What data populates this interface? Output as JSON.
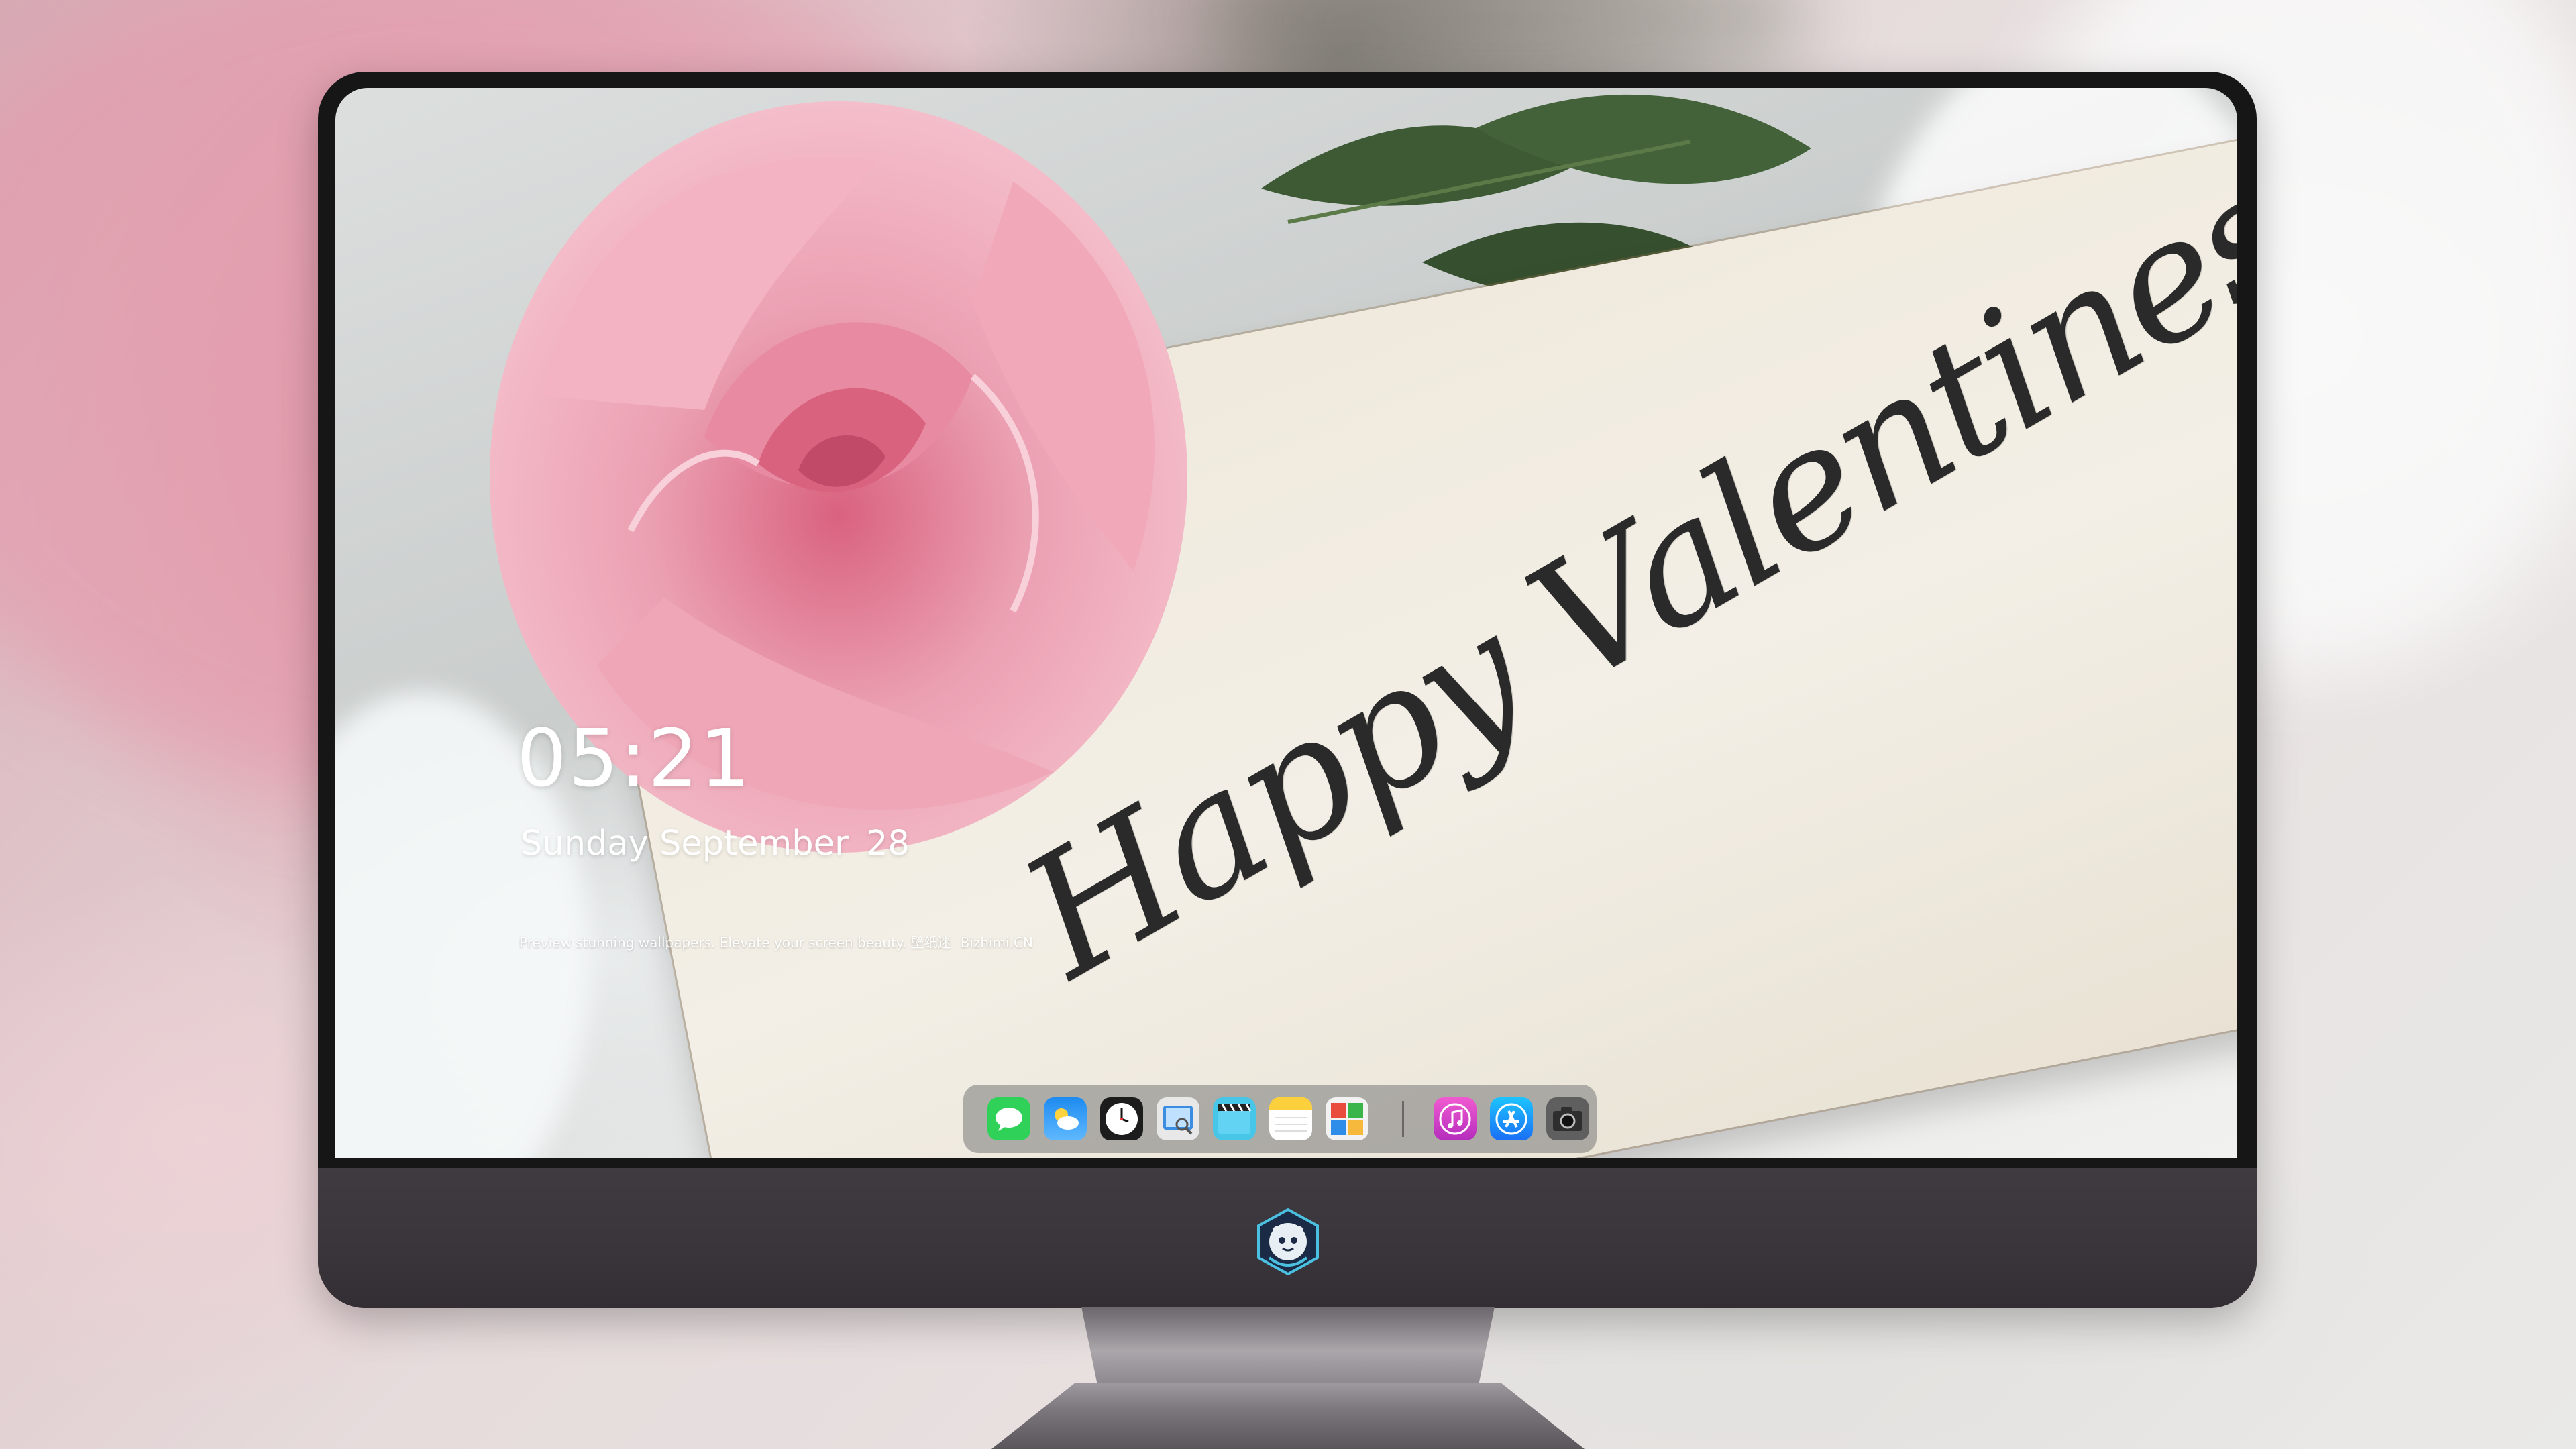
{
  "lock_screen": {
    "time": "05:21",
    "weekday_month": "Sunday September",
    "day": "28",
    "tagline": "Preview stunning wallpapers. Elevate your screen beauty. 壁纸迷",
    "site": "Bizhimi.CN"
  },
  "wallpaper": {
    "card_text": "Happy Valentines Day"
  },
  "dock": {
    "apps": [
      {
        "name": "messages-icon",
        "color": "#2fd158"
      },
      {
        "name": "weather-icon",
        "color": "#1e8bf0"
      },
      {
        "name": "clock-icon",
        "color": "#ffffff"
      },
      {
        "name": "preview-icon",
        "color": "#3a8de0"
      },
      {
        "name": "video-clips-icon",
        "color": "#48c6e8"
      },
      {
        "name": "notes-icon",
        "color": "#fccf3c"
      },
      {
        "name": "photo-booth-icon",
        "color": "#e94b3c"
      },
      {
        "name": "music-icon",
        "color": "#e33aa8"
      },
      {
        "name": "app-store-icon",
        "color": "#1a8ef5"
      },
      {
        "name": "camera-icon",
        "color": "#5f5f5f"
      }
    ]
  },
  "device": {
    "chin_logo": "mascot-logo-icon"
  }
}
